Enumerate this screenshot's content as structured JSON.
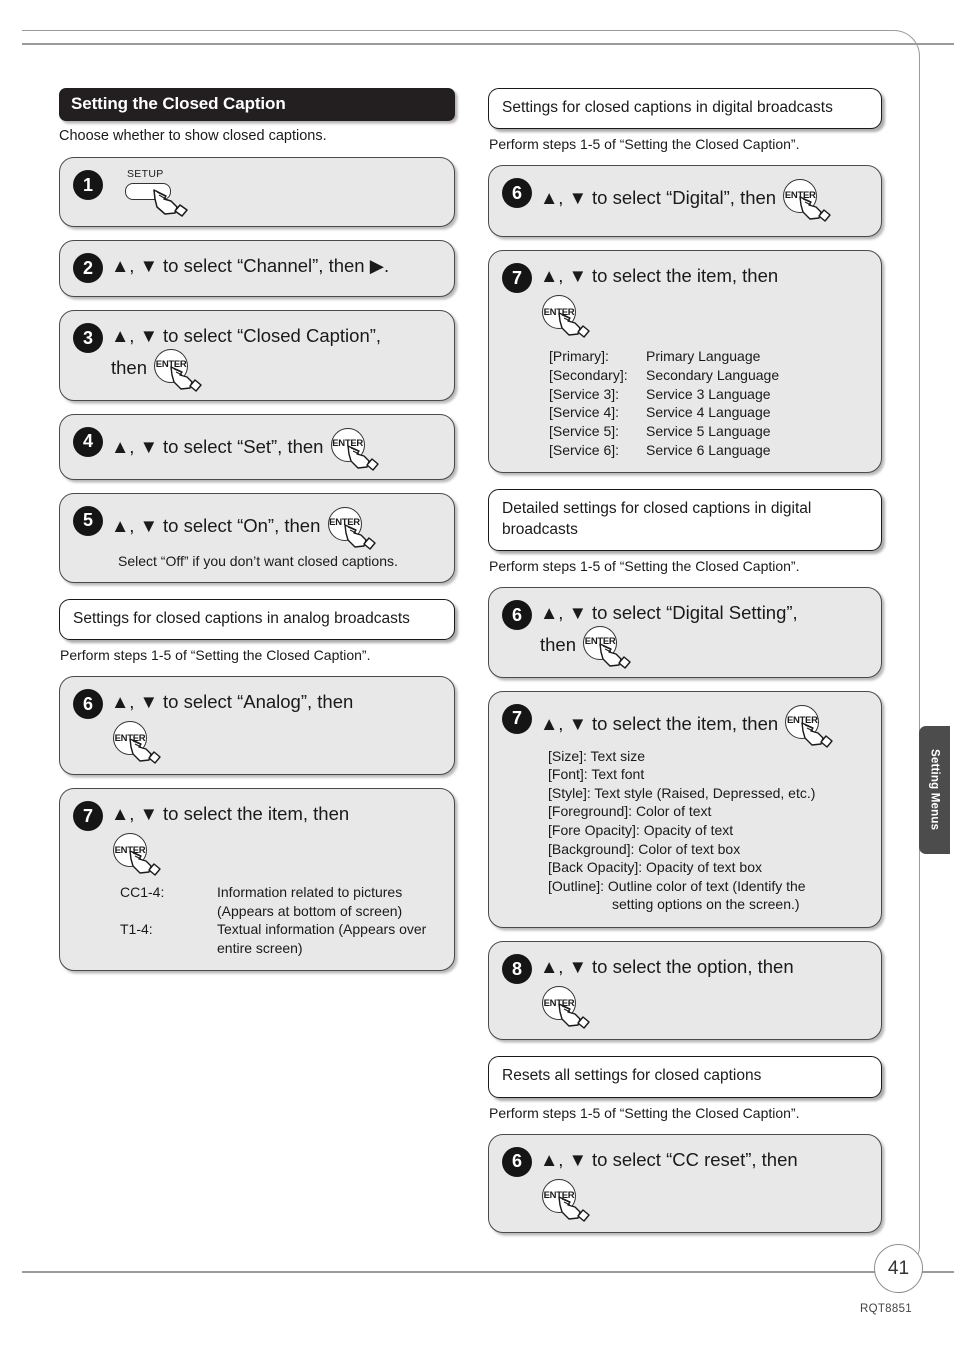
{
  "document": {
    "page_number": "41",
    "doc_code": "RQT8851",
    "side_tab_label": "Setting Menus"
  },
  "left_column": {
    "title_bar": "Setting the Closed Caption",
    "intro": "Choose whether to show closed captions.",
    "steps": [
      {
        "number": "1",
        "key": "SETUP",
        "text": ""
      },
      {
        "number": "2",
        "text": "▲, ▼ to select “Channel”, then ▶."
      },
      {
        "number": "3",
        "text": "▲, ▼ to select “Closed Caption”,",
        "text2": "then",
        "enter_label": "ENTER"
      },
      {
        "number": "4",
        "text": "▲, ▼ to select “Set”, then",
        "enter_label": "ENTER"
      },
      {
        "number": "5",
        "text": "▲, ▼ to select “On”, then",
        "enter_label": "ENTER",
        "note": "Select “Off” if you don’t want closed captions."
      }
    ],
    "analog_section": {
      "header": "Settings for closed captions in analog broadcasts",
      "perform_note": "Perform steps 1-5 of “Setting the Closed Caption”.",
      "steps": [
        {
          "number": "6",
          "text": "▲, ▼ to select “Analog”, then",
          "enter_label": "ENTER"
        },
        {
          "number": "7",
          "text": "▲, ▼ to select the item, then",
          "enter_label": "ENTER",
          "items": [
            {
              "key": "CC1-4:",
              "value": "Information related to pictures"
            },
            {
              "key": "",
              "value": "(Appears at bottom of screen)"
            },
            {
              "key": "T1-4:",
              "value": "Textual information (Appears over"
            },
            {
              "key": "",
              "value": "entire screen)"
            }
          ]
        }
      ]
    }
  },
  "right_column": {
    "digital_section": {
      "header": "Settings for closed captions in digital broadcasts",
      "perform_note": "Perform steps 1-5 of “Setting the Closed Caption”.",
      "steps": [
        {
          "number": "6",
          "text": "▲, ▼ to select “Digital”, then",
          "enter_label": "ENTER"
        },
        {
          "number": "7",
          "text": "▲, ▼ to select the item, then",
          "enter_label": "ENTER",
          "items": [
            {
              "key": "[Primary]:",
              "value": "Primary Language"
            },
            {
              "key": "[Secondary]:",
              "value": "Secondary Language"
            },
            {
              "key": "[Service 3]:",
              "value": "Service 3 Language"
            },
            {
              "key": "[Service 4]:",
              "value": "Service 4 Language"
            },
            {
              "key": "[Service 5]:",
              "value": "Service 5 Language"
            },
            {
              "key": "[Service 6]:",
              "value": "Service 6 Language"
            }
          ]
        }
      ]
    },
    "detailed_section": {
      "header": "Detailed settings for closed captions in digital broadcasts",
      "perform_note": "Perform steps 1-5 of “Setting the Closed Caption”.",
      "steps": [
        {
          "number": "6",
          "text": "▲, ▼ to select “Digital Setting”,",
          "text2": "then",
          "enter_label": "ENTER"
        },
        {
          "number": "7",
          "text": "▲, ▼ to select the item, then",
          "enter_label": "ENTER",
          "lines": [
            "[Size]: Text size",
            "[Font]: Text font",
            "[Style]: Text style (Raised, Depressed, etc.)",
            "[Foreground]: Color of text",
            "[Fore Opacity]: Opacity of text",
            "[Background]: Color of text box",
            "[Back Opacity]: Opacity of text box",
            "[Outline]: Outline color of text (Identify the"
          ],
          "last_line_indented": "setting options on the screen.)"
        },
        {
          "number": "8",
          "text": "▲, ▼ to select the option, then",
          "enter_label": "ENTER"
        }
      ]
    },
    "reset_section": {
      "header": "Resets all settings for closed captions",
      "perform_note": "Perform steps 1-5 of “Setting the Closed Caption”.",
      "steps": [
        {
          "number": "6",
          "text": "▲, ▼ to select “CC reset”, then",
          "enter_label": "ENTER"
        }
      ]
    }
  }
}
